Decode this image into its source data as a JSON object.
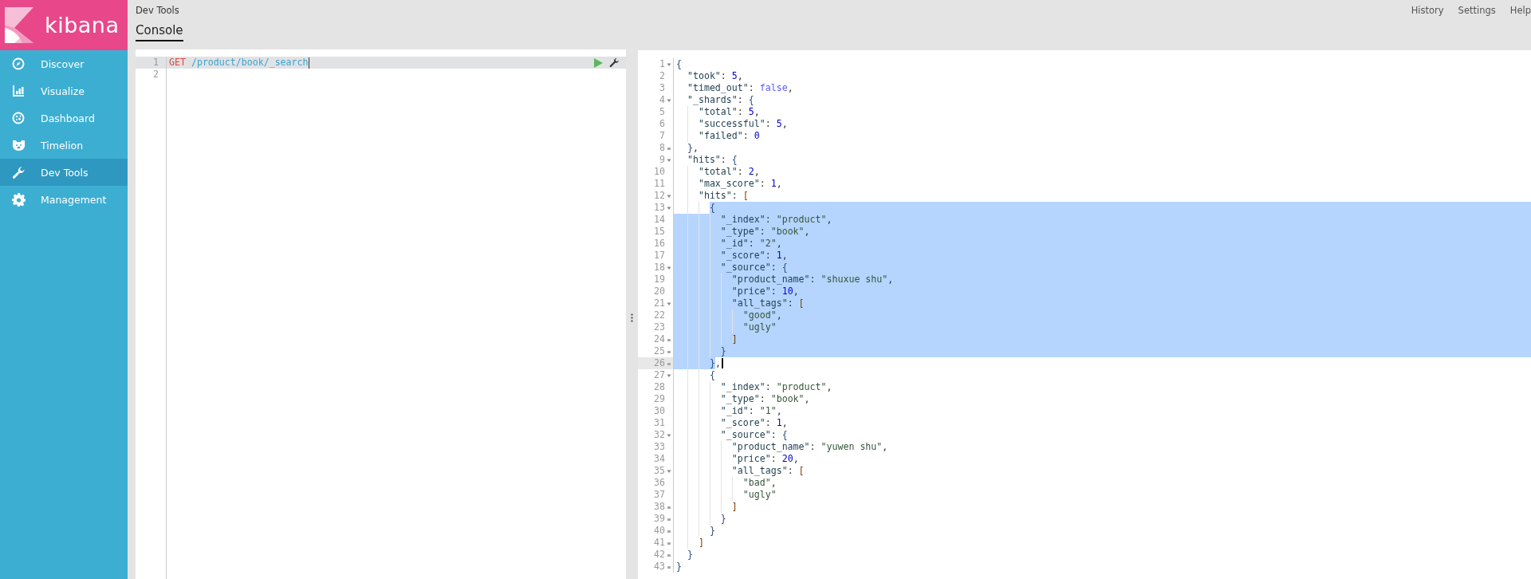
{
  "sidebar": {
    "logo": "kibana",
    "items": [
      {
        "label": "Discover",
        "selected": false
      },
      {
        "label": "Visualize",
        "selected": false
      },
      {
        "label": "Dashboard",
        "selected": false
      },
      {
        "label": "Timelion",
        "selected": false
      },
      {
        "label": "Dev Tools",
        "selected": true
      },
      {
        "label": "Management",
        "selected": false
      }
    ]
  },
  "header": {
    "title": "Dev Tools",
    "tabs": [
      {
        "label": "Console",
        "selected": true
      }
    ],
    "links": [
      "History",
      "Settings",
      "Help"
    ]
  },
  "request": {
    "lines": [
      {
        "n": "1",
        "method": "GET",
        "path": "/product/book/_search",
        "active": true
      },
      {
        "n": "2",
        "active": false
      }
    ]
  },
  "response": {
    "lines": [
      {
        "n": "1",
        "text": "{",
        "kind": "open",
        "selected": false
      },
      {
        "n": "2",
        "text": "  \"took\": 5,",
        "kind": "plain",
        "selected": false
      },
      {
        "n": "3",
        "text": "  \"timed_out\": false,",
        "kind": "plain",
        "selected": false
      },
      {
        "n": "4",
        "text": "  \"_shards\": {",
        "kind": "open",
        "selected": false
      },
      {
        "n": "5",
        "text": "    \"total\": 5,",
        "kind": "plain",
        "selected": false
      },
      {
        "n": "6",
        "text": "    \"successful\": 5,",
        "kind": "plain",
        "selected": false
      },
      {
        "n": "7",
        "text": "    \"failed\": 0",
        "kind": "plain",
        "selected": false
      },
      {
        "n": "8",
        "text": "  },",
        "kind": "close",
        "selected": false
      },
      {
        "n": "9",
        "text": "  \"hits\": {",
        "kind": "open",
        "selected": false
      },
      {
        "n": "10",
        "text": "    \"total\": 2,",
        "kind": "plain",
        "selected": false
      },
      {
        "n": "11",
        "text": "    \"max_score\": 1,",
        "kind": "plain",
        "selected": false
      },
      {
        "n": "12",
        "text": "    \"hits\": [",
        "kind": "open",
        "selected": false
      },
      {
        "n": "13",
        "text": "      {",
        "kind": "open",
        "selected": true
      },
      {
        "n": "14",
        "text": "        \"_index\": \"product\",",
        "kind": "plain",
        "selected": true
      },
      {
        "n": "15",
        "text": "        \"_type\": \"book\",",
        "kind": "plain",
        "selected": true
      },
      {
        "n": "16",
        "text": "        \"_id\": \"2\",",
        "kind": "plain",
        "selected": true
      },
      {
        "n": "17",
        "text": "        \"_score\": 1,",
        "kind": "plain",
        "selected": true
      },
      {
        "n": "18",
        "text": "        \"_source\": {",
        "kind": "open",
        "selected": true
      },
      {
        "n": "19",
        "text": "          \"product_name\": \"shuxue shu\",",
        "kind": "plain",
        "selected": true
      },
      {
        "n": "20",
        "text": "          \"price\": 10,",
        "kind": "plain",
        "selected": true
      },
      {
        "n": "21",
        "text": "          \"all_tags\": [",
        "kind": "open",
        "selected": true
      },
      {
        "n": "22",
        "text": "            \"good\",",
        "kind": "plain",
        "selected": true
      },
      {
        "n": "23",
        "text": "            \"ugly\"",
        "kind": "plain",
        "selected": true
      },
      {
        "n": "24",
        "text": "          ]",
        "kind": "close",
        "selected": true
      },
      {
        "n": "25",
        "text": "        }",
        "kind": "close",
        "selected": true
      },
      {
        "n": "26",
        "text": "      },",
        "kind": "close",
        "selected": true
      },
      {
        "n": "27",
        "text": "      {",
        "kind": "open",
        "selected": false
      },
      {
        "n": "28",
        "text": "        \"_index\": \"product\",",
        "kind": "plain",
        "selected": false
      },
      {
        "n": "29",
        "text": "        \"_type\": \"book\",",
        "kind": "plain",
        "selected": false
      },
      {
        "n": "30",
        "text": "        \"_id\": \"1\",",
        "kind": "plain",
        "selected": false
      },
      {
        "n": "31",
        "text": "        \"_score\": 1,",
        "kind": "plain",
        "selected": false
      },
      {
        "n": "32",
        "text": "        \"_source\": {",
        "kind": "open",
        "selected": false
      },
      {
        "n": "33",
        "text": "          \"product_name\": \"yuwen shu\",",
        "kind": "plain",
        "selected": false
      },
      {
        "n": "34",
        "text": "          \"price\": 20,",
        "kind": "plain",
        "selected": false
      },
      {
        "n": "35",
        "text": "          \"all_tags\": [",
        "kind": "open",
        "selected": false
      },
      {
        "n": "36",
        "text": "            \"bad\",",
        "kind": "plain",
        "selected": false
      },
      {
        "n": "37",
        "text": "            \"ugly\"",
        "kind": "plain",
        "selected": false
      },
      {
        "n": "38",
        "text": "          ]",
        "kind": "close",
        "selected": false
      },
      {
        "n": "39",
        "text": "        }",
        "kind": "close",
        "selected": false
      },
      {
        "n": "40",
        "text": "      }",
        "kind": "close",
        "selected": false
      },
      {
        "n": "41",
        "text": "    ]",
        "kind": "close",
        "selected": false
      },
      {
        "n": "42",
        "text": "  }",
        "kind": "close",
        "selected": false
      },
      {
        "n": "43",
        "text": "}",
        "kind": "close",
        "selected": false
      }
    ]
  }
}
